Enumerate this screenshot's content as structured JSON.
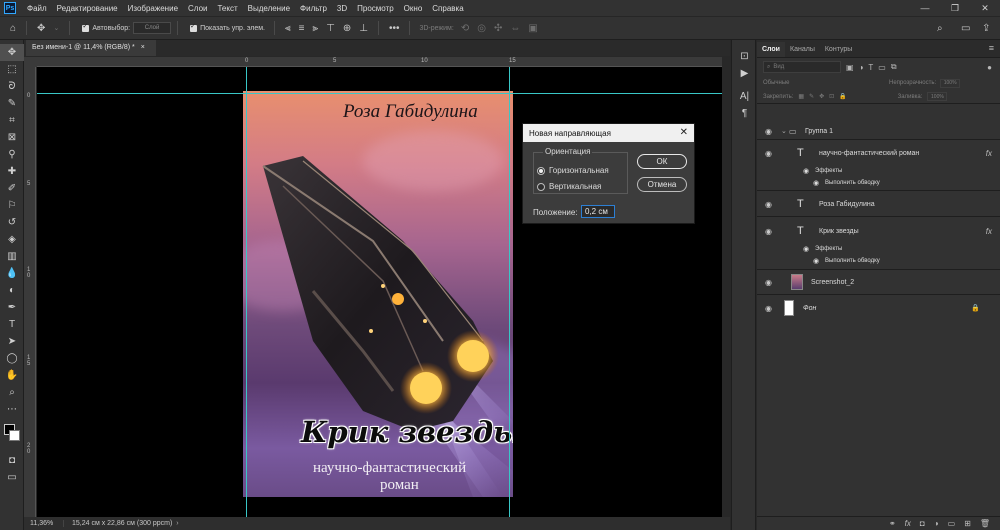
{
  "app": {
    "logo": "Ps",
    "menu": [
      "Файл",
      "Редактирование",
      "Изображение",
      "Слои",
      "Текст",
      "Выделение",
      "Фильтр",
      "3D",
      "Просмотр",
      "Окно",
      "Справка"
    ]
  },
  "options_bar": {
    "autoselect_label": "Автовыбор:",
    "autoselect_value": "Слой",
    "show_controls_label": "Показать упр. элем.",
    "mode_3d_label": "3D-режим:"
  },
  "document": {
    "tab_title": "Без имени-1 @ 11,4% (RGB/8) *",
    "tab_close": "×"
  },
  "rulers": {
    "top": [
      "0",
      "5",
      "10",
      "15"
    ],
    "left": [
      "0",
      "5",
      "1\n0",
      "1\n5",
      "2\n0"
    ]
  },
  "cover": {
    "author": "Роза Габидулина",
    "title": "Крик звезды",
    "subtitle_line1": "научно-фантастический",
    "subtitle_line2": "роман"
  },
  "dialog": {
    "title": "Новая направляющая",
    "close": "✕",
    "orientation_label": "Ориентация",
    "option_horizontal": "Горизонтальная",
    "option_vertical": "Вертикальная",
    "selected": "horizontal",
    "ok_label": "ОК",
    "cancel_label": "Отмена",
    "position_label": "Положение:",
    "position_value": "0,2 см"
  },
  "status_bar": {
    "zoom": "11,36%",
    "doc_info": "15,24 см x 22,86 см (300 ppcm)"
  },
  "layers_panel": {
    "tabs": [
      "Слои",
      "Каналы",
      "Контуры"
    ],
    "active_tab": 0,
    "filter_placeholder": "Вид",
    "blend_mode": "Обычные",
    "opacity_label": "Непрозрачность:",
    "opacity_value": "100%",
    "lock_label": "Закрепить:",
    "fill_label": "Заливка:",
    "fill_value": "100%",
    "effects_label": "Эффекты",
    "stroke_label": "Выполнить обводку",
    "layers": [
      {
        "name": "Группа 1",
        "kind": "group"
      },
      {
        "name": "научно-фантастический  роман",
        "kind": "text",
        "fx": true
      },
      {
        "name": "Роза Габидулина",
        "kind": "text"
      },
      {
        "name": "Крик звезды",
        "kind": "text",
        "fx": true
      },
      {
        "name": "Screenshot_2",
        "kind": "image"
      },
      {
        "name": "Фон",
        "kind": "background",
        "locked": true
      }
    ],
    "fx_badge": "fx"
  },
  "colors": {
    "guide": "#39c7c7",
    "accent_blue": "#31a8ff",
    "panel_bg": "#323232",
    "canvas_bg": "#000000"
  }
}
